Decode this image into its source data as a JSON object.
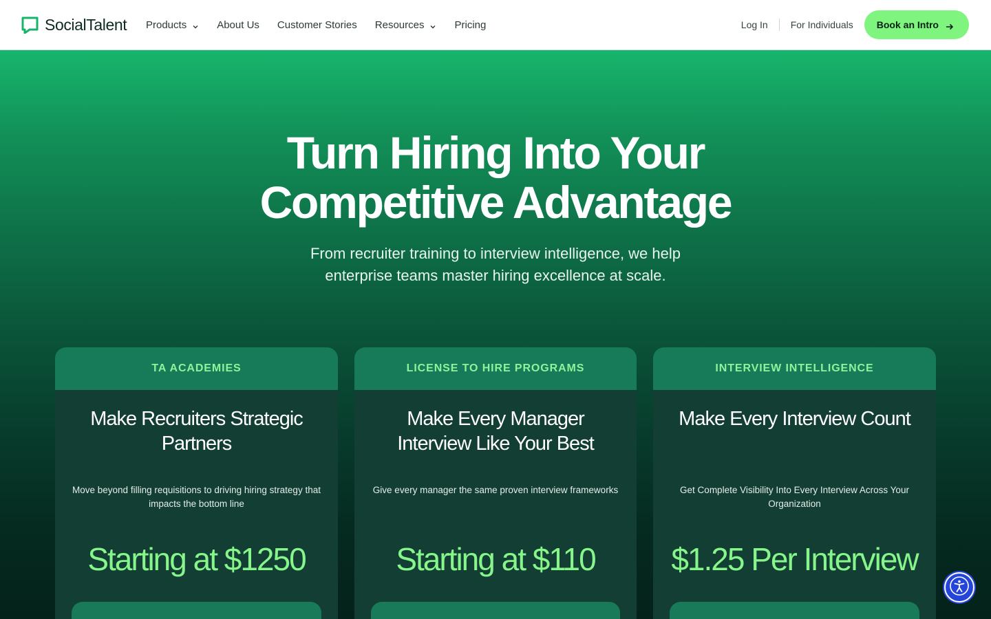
{
  "header": {
    "logo_text": "SocialTalent",
    "nav": [
      {
        "label": "Products",
        "has_dropdown": true
      },
      {
        "label": "About Us",
        "has_dropdown": false
      },
      {
        "label": "Customer Stories",
        "has_dropdown": false
      },
      {
        "label": "Resources",
        "has_dropdown": true
      },
      {
        "label": "Pricing",
        "has_dropdown": false
      }
    ],
    "login": "Log In",
    "individuals": "For Individuals",
    "cta": "Book an Intro"
  },
  "hero": {
    "title_line1": "Turn Hiring Into Your",
    "title_line2": "Competitive Advantage",
    "subtitle": "From recruiter training to interview intelligence, we help enterprise teams master hiring excellence at scale."
  },
  "cards": [
    {
      "tag": "TA ACADEMIES",
      "title": "Make Recruiters Strategic Partners",
      "description": "Move beyond filling requisitions to driving hiring strategy that impacts the bottom line",
      "price": "Starting at $1250"
    },
    {
      "tag": "LICENSE TO HIRE PROGRAMS",
      "title": "Make Every Manager Interview Like Your Best",
      "description": "Give every manager the same proven interview frameworks",
      "price": "Starting at $110"
    },
    {
      "tag": "INTERVIEW INTELLIGENCE",
      "title": "Make Every Interview Count",
      "description": "Get Complete Visibility Into Every Interview Across Your Organization",
      "price": "$1.25 Per Interview"
    }
  ],
  "colors": {
    "brand_green": "#17b56c",
    "accent_lime": "#7ff57f",
    "card_bg": "#133e34",
    "card_header": "#177b5a",
    "accessibility_blue": "#2545d9"
  },
  "icons": {
    "logo": "speech-bubble-icon",
    "dropdown": "chevron-down-icon",
    "cta_arrow": "arrow-right-icon",
    "accessibility": "accessibility-icon"
  }
}
